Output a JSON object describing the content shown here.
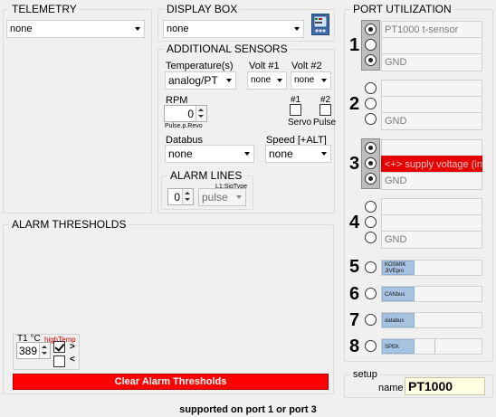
{
  "telemetry": {
    "legend": "TELEMETRY",
    "value": "none"
  },
  "display_box": {
    "legend": "DISPLAY BOX",
    "value": "none",
    "icon": "display-box-icon"
  },
  "additional_sensors": {
    "legend": "ADDITIONAL SENSORS",
    "temperature_label": "Temperature(s)",
    "temperature_value": "analog/PT",
    "volt1_label": "Volt #1",
    "volt1_value": "none",
    "volt2_label": "Volt #2",
    "volt2_value": "none",
    "rpm_label": "RPM",
    "rpm_value": "0",
    "rpm_sub": "Pulse.p.Revo",
    "servo_num": "#1",
    "pulse_num": "#2",
    "servo_label": "Servo",
    "pulse_label": "Pulse",
    "databus_label": "Databus",
    "databus_value": "none",
    "speed_label": "Speed [+ALT]",
    "speed_value": "none"
  },
  "alarm_lines": {
    "legend": "ALARM LINES",
    "sig_label": "L1:SigType",
    "count_value": "0",
    "type_value": "pulse"
  },
  "alarm_thresholds": {
    "legend": "ALARM THRESHOLDS",
    "t1_label": "T1 °C",
    "t1_alarm": "highTemp",
    "t1_value": "389",
    "gt": ">",
    "lt": "<",
    "clear_button": "Clear Alarm Thresholds"
  },
  "port_utilization": {
    "legend": "PORT UTILIZATION",
    "ports": [
      {
        "num": "1",
        "line1": "PT1000 t-sensor",
        "line2": "",
        "line3": "GND",
        "radio": [
          true,
          false,
          true
        ]
      },
      {
        "num": "2",
        "line1": "",
        "line2": "",
        "line3": "GND",
        "radio": [
          false,
          false,
          false
        ]
      },
      {
        "num": "3",
        "line1": "",
        "line2": "<+> supply voltage (in)",
        "line3": "GND",
        "radio": [
          true,
          true,
          true
        ]
      },
      {
        "num": "4",
        "line1": "",
        "line2": "",
        "line3": "GND",
        "radio": [
          false,
          false,
          false
        ]
      }
    ],
    "small_ports": [
      {
        "num": "5",
        "label": "KOSMIK\nJIVEpro"
      },
      {
        "num": "6",
        "label": "CANbus"
      },
      {
        "num": "7",
        "label": "databus"
      },
      {
        "num": "8",
        "label": "SPEK"
      }
    ]
  },
  "setup": {
    "legend": "setup",
    "name_label": "name",
    "name_value": "PT1000"
  },
  "footer": {
    "note": "supported on port 1 or port 3"
  },
  "colors": {
    "alarm_red": "#ff0000",
    "supply_red": "#e60000",
    "strip_blue": "#a7c3e2",
    "name_bg": "#fffee0"
  }
}
